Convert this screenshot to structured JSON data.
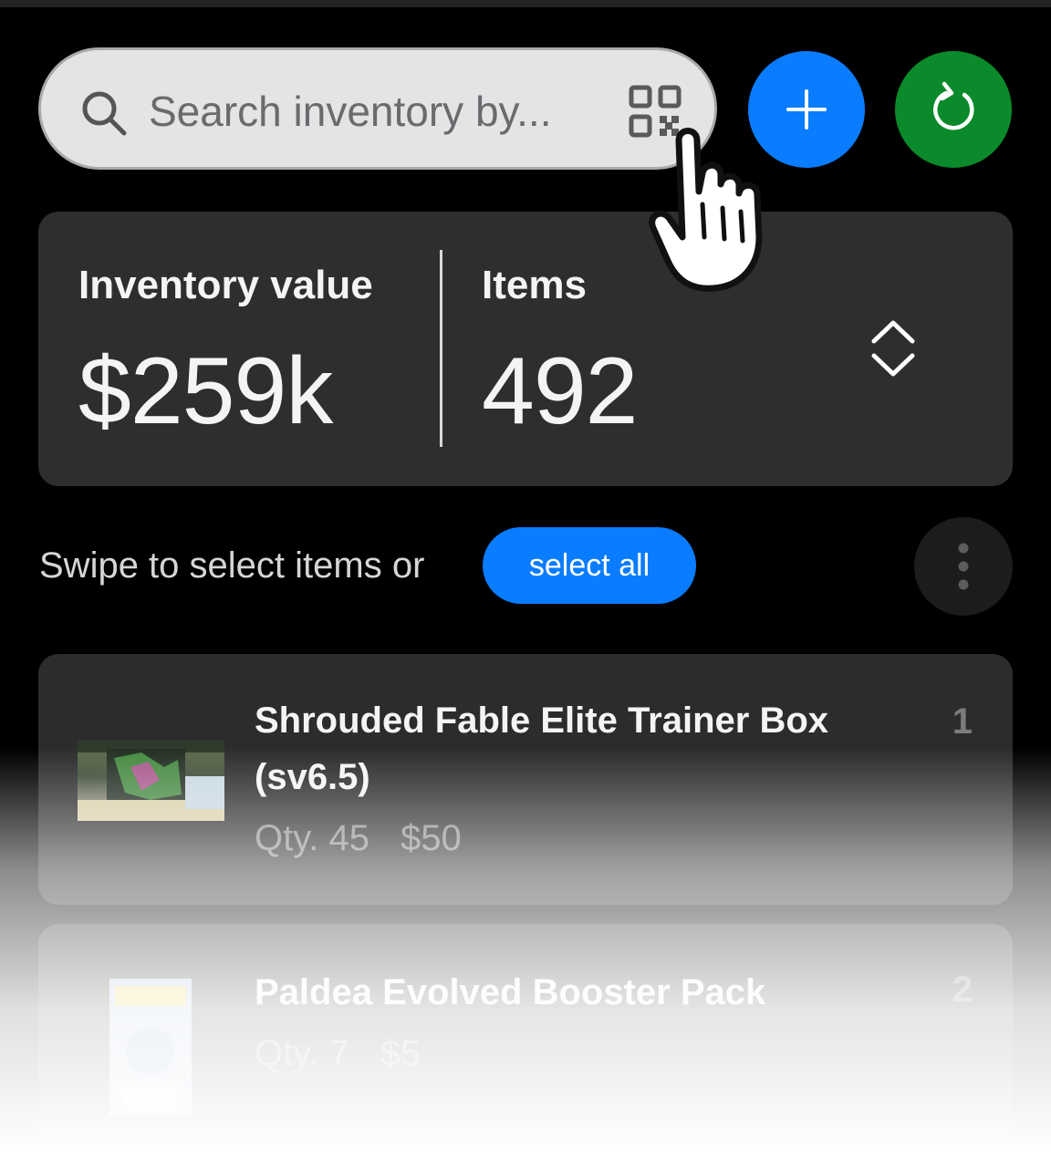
{
  "search": {
    "placeholder": "Search inventory by...",
    "search_icon": "magnifier-icon",
    "scan_icon": "qr-code-icon"
  },
  "header_actions": {
    "add_icon": "plus-icon",
    "refresh_icon": "refresh-icon",
    "add_color": "#0a7cff",
    "refresh_color": "#0a8a2a"
  },
  "stats": {
    "inventory_value_label": "Inventory value",
    "inventory_value": "$259k",
    "items_label": "Items",
    "items_count": "492",
    "sort_icon": "chevron-up-down-icon"
  },
  "selection": {
    "hint": "Swipe to select items or",
    "select_all_label": "select all",
    "more_icon": "more-vertical-icon"
  },
  "items": [
    {
      "title": "Shrouded Fable Elite Trainer Box (sv6.5)",
      "qty": "Qty. 45",
      "price": "$50",
      "rank": "1"
    },
    {
      "title": "Paldea Evolved Booster Pack",
      "qty": "Qty. 7",
      "price": "$5",
      "rank": "2"
    }
  ],
  "cursor": "hand-pointer-icon"
}
